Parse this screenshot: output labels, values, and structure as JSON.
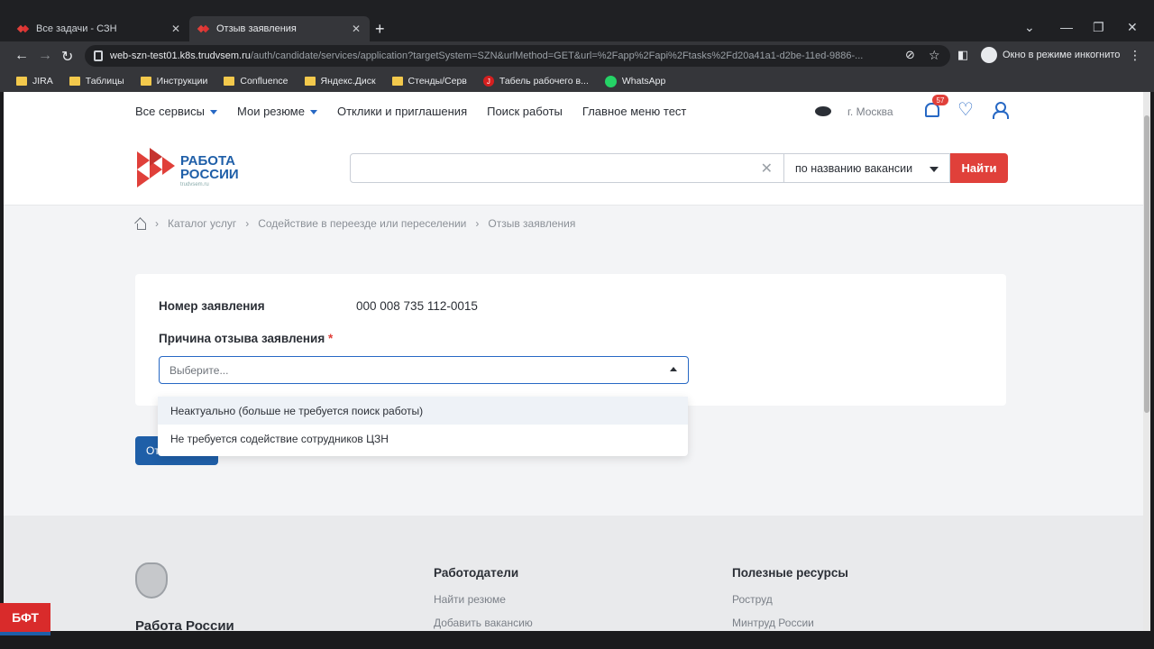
{
  "browser": {
    "tabs": [
      {
        "title": "Все задачи - СЗН"
      },
      {
        "title": "Отзыв заявления"
      }
    ],
    "url_host": "web-szn-test01.k8s.trudvsem.ru",
    "url_path": "/auth/candidate/services/application?targetSystem=SZN&urlMethod=GET&url=%2Fapp%2Fapi%2Ftasks%2Fd20a41a1-d2be-11ed-9886-...",
    "incognito_label": "Окно в режиме инкогнито",
    "bookmarks": [
      {
        "label": "JIRA",
        "icon": "folder"
      },
      {
        "label": "Таблицы",
        "icon": "folder"
      },
      {
        "label": "Инструкции",
        "icon": "folder"
      },
      {
        "label": "Confluence",
        "icon": "folder"
      },
      {
        "label": "Яндекс.Диск",
        "icon": "folder"
      },
      {
        "label": "Стенды/Серв",
        "icon": "folder"
      },
      {
        "label": "Табель рабочего в...",
        "icon": "j-icon"
      },
      {
        "label": "WhatsApp",
        "icon": "whatsapp"
      }
    ]
  },
  "header": {
    "nav": [
      {
        "label": "Все сервисы",
        "has_caret": true
      },
      {
        "label": "Мои резюме",
        "has_caret": true
      },
      {
        "label": "Отклики и приглашения",
        "has_caret": false
      },
      {
        "label": "Поиск работы",
        "has_caret": false
      },
      {
        "label": "Главное меню тест",
        "has_caret": false
      }
    ],
    "city": "г. Москва",
    "notifications_count": "57",
    "logo_line1": "РАБОТА",
    "logo_line2": "РОССИИ",
    "logo_sub": "trudvsem.ru",
    "search_value": "",
    "search_type": "по названию вакансии",
    "search_button": "Найти"
  },
  "breadcrumb": [
    "Каталог услуг",
    "Содействие в переезде или переселении",
    "Отзыв заявления"
  ],
  "form": {
    "number_label": "Номер заявления",
    "number_value": "000 008 735 112-0015",
    "reason_label": "Причина отзыва заявления",
    "required_mark": "*",
    "select_placeholder": "Выберите...",
    "options": [
      "Неактуально (больше не требуется поиск работы)",
      "Не требуется содействие сотрудников ЦЗН"
    ],
    "submit_label_visible": "От"
  },
  "footer": {
    "brand": "Работа России",
    "col1_title": "Работодатели",
    "col1_links": [
      "Найти резюме",
      "Добавить вакансию"
    ],
    "col2_title": "Полезные ресурсы",
    "col2_links": [
      "Роструд",
      "Минтруд России"
    ]
  },
  "overlay_badge": "БФТ",
  "colors": {
    "brand_blue": "#1f5fa8",
    "accent_red": "#e0403a",
    "link_blue": "#2768c4"
  }
}
